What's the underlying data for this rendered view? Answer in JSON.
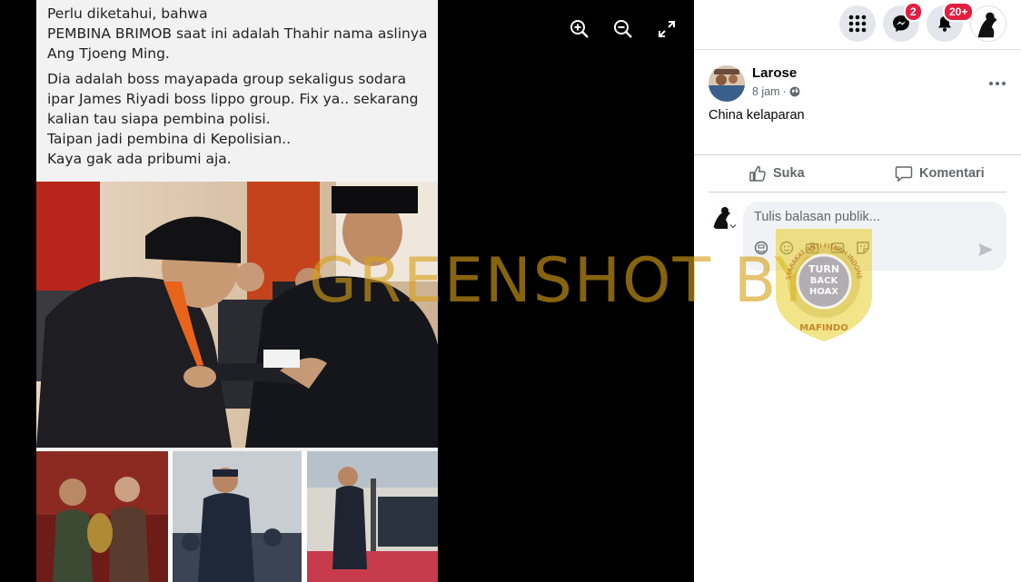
{
  "photo_caption": {
    "line1": "Perlu diketahui, bahwa",
    "line2": "PEMBINA BRIMOB saat ini adalah Thahir nama aslinya",
    "line3": "Ang Tjoeng Ming.",
    "line4": "Dia adalah boss mayapada group sekaligus sodara",
    "line5": "ipar James Riyadi boss lippo group. Fix ya.. sekarang",
    "line6": "kalian tau siapa pembina polisi.",
    "line7": "Taipan jadi pembina di Kepolisian..",
    "line8": "Kaya gak ada pribumi aja."
  },
  "viewer_tools": {
    "zoom_in_icon": "zoom-in-icon",
    "zoom_out_icon": "zoom-out-icon",
    "fullscreen_icon": "expand-icon"
  },
  "overlay": {
    "watermark": "GREENSHOT BY",
    "badge_top": "MASYARAKAT ANTI FITNAH INDONESIA",
    "badge_line1": "TURN",
    "badge_line2": "BACK",
    "badge_line3": "HOAX",
    "badge_bottom": "MAFINDO"
  },
  "topbar": {
    "messenger_count": "2",
    "notifications_count": "20+"
  },
  "post": {
    "author": "Larose",
    "time": "8 jam",
    "dot": "·",
    "text": "China kelaparan"
  },
  "actions": {
    "like": "Suka",
    "comment": "Komentari"
  },
  "reply": {
    "placeholder": "Tulis balasan publik..."
  },
  "colors": {
    "badge_red": "#e41e3f",
    "watermark": "#d6a019",
    "panel_bg": "#ffffff",
    "secondary_text": "#65676b"
  }
}
